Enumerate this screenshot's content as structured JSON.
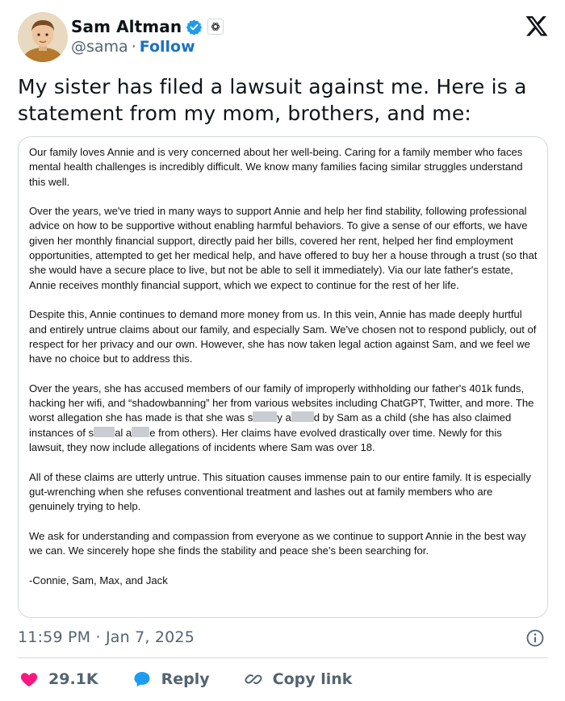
{
  "author": {
    "name": "Sam Altman",
    "handle": "@sama",
    "separator": "·",
    "follow_label": "Follow",
    "verified_color": "#1d9bf0"
  },
  "tweet": {
    "text": "My sister has filed a lawsuit against me. Here is a statement from my mom, brothers, and me:",
    "timestamp": "11:59 PM · Jan 7, 2025"
  },
  "statement": {
    "p1": "Our family loves Annie and is very concerned about her well-being. Caring for a family member who faces mental health challenges is incredibly difficult. We know many families facing similar struggles understand this well.",
    "p2": "Over the years, we've tried in many ways to support Annie and help her find stability, following professional advice on how to be supportive without enabling harmful behaviors. To give a sense of our efforts, we have given her monthly financial support, directly paid her bills, covered her rent, helped her find employment opportunities, attempted to get her medical help, and have offered to buy her a house through a trust (so that she would have a secure place to live, but not be able to sell it immediately). Via our late father's estate, Annie receives monthly financial support, which we expect to continue for the rest of her life.",
    "p3": "Despite this, Annie continues to demand more money from us. In this vein, Annie has made deeply hurtful and entirely untrue claims about our family, and especially Sam. We've chosen not to respond publicly, out of respect for her privacy and our own. However, she has now taken legal action against Sam, and we feel we have no choice but to address this.",
    "p4a": "Over the years, she has accused members of our family of improperly withholding our father's 401k funds, hacking her wifi, and “shadowbanning” her from various websites including ChatGPT, Twitter, and more. The worst allegation she has made is that she was s",
    "p4b": "y a",
    "p4c": "d by Sam as a child (she has also claimed instances of s",
    "p4d": "al a",
    "p4e": "e from others). Her claims have evolved drastically over time. Newly for this lawsuit, they now include allegations of incidents where Sam was over 18.",
    "p5": "All of these claims are utterly untrue. This situation causes immense pain to our entire family. It is especially gut-wrenching when she refuses conventional treatment and lashes out at family members who are genuinely trying to help.",
    "p6": "We ask for understanding and compassion from everyone as we continue to support Annie in the best way we can. We sincerely hope she finds the stability and peace she's been searching for.",
    "signature": "-Connie, Sam, Max, and Jack"
  },
  "actions": {
    "likes_count": "29.1K",
    "reply_label": "Reply",
    "copy_link_label": "Copy link",
    "like_color": "#f91880",
    "reply_color": "#1d9bf0"
  },
  "icons": {
    "x_logo": "x-logo-icon",
    "verified": "verified-badge-icon",
    "org": "openai-badge-icon",
    "info": "info-icon",
    "heart": "heart-icon",
    "reply": "reply-bubble-icon",
    "link": "link-icon"
  }
}
